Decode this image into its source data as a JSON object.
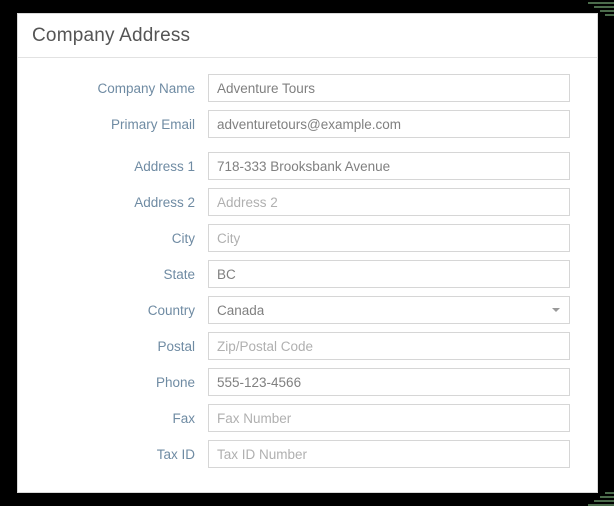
{
  "panel": {
    "title": "Company Address"
  },
  "form": {
    "fields": [
      {
        "label": "Company Name",
        "value": "Adventure Tours",
        "placeholder": "",
        "type": "text",
        "filled": true,
        "name": "company-name"
      },
      {
        "label": "Primary Email",
        "value": "adventuretours@example.com",
        "placeholder": "",
        "type": "text",
        "filled": true,
        "name": "primary-email"
      },
      {
        "label": "Address 1",
        "value": "718-333 Brooksbank Avenue",
        "placeholder": "",
        "type": "text",
        "filled": true,
        "name": "address-1"
      },
      {
        "label": "Address 2",
        "value": "",
        "placeholder": "Address 2",
        "type": "text",
        "filled": false,
        "name": "address-2"
      },
      {
        "label": "City",
        "value": "",
        "placeholder": "City",
        "type": "text",
        "filled": false,
        "name": "city"
      },
      {
        "label": "State",
        "value": "BC",
        "placeholder": "",
        "type": "text",
        "filled": true,
        "name": "state"
      },
      {
        "label": "Country",
        "value": "Canada",
        "placeholder": "",
        "type": "select",
        "filled": true,
        "name": "country"
      },
      {
        "label": "Postal",
        "value": "",
        "placeholder": "Zip/Postal Code",
        "type": "text",
        "filled": false,
        "name": "postal"
      },
      {
        "label": "Phone",
        "value": "555-123-4566",
        "placeholder": "",
        "type": "text",
        "filled": true,
        "name": "phone"
      },
      {
        "label": "Fax",
        "value": "",
        "placeholder": "Fax Number",
        "type": "text",
        "filled": false,
        "name": "fax"
      },
      {
        "label": "Tax ID",
        "value": "",
        "placeholder": "Tax ID Number",
        "type": "text",
        "filled": false,
        "name": "tax-id"
      }
    ],
    "group_break_after_index": 1,
    "select_icon": "chevron-down-icon"
  },
  "colors": {
    "label": "#6f8ba3",
    "value": "#808080",
    "placeholder": "#b0b0b0",
    "title": "#555555",
    "border": "#d6d6d6",
    "panel_bg": "#ffffff",
    "frame": "#000000"
  }
}
